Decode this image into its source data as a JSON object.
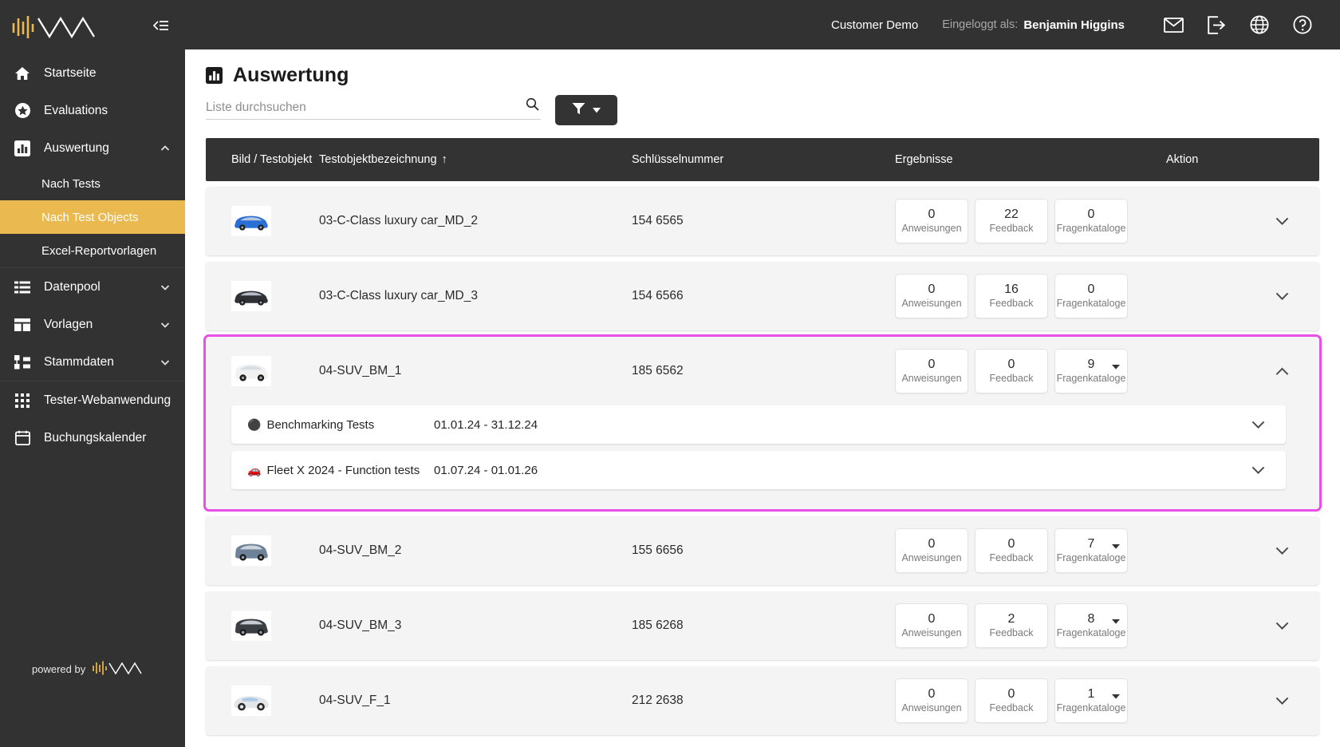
{
  "sidebar": {
    "brand_logo_name": "app-logo",
    "collapse_icon": "collapse-sidebar-icon",
    "items": [
      {
        "label": "Startseite",
        "icon": "home-icon",
        "type": "link",
        "active": false
      },
      {
        "label": "Evaluations",
        "icon": "star-icon",
        "type": "link",
        "active": false
      },
      {
        "label": "Auswertung",
        "icon": "bar-chart-icon",
        "type": "group",
        "expanded": true,
        "chevron": "chevron-up-icon"
      },
      {
        "label": "Nach Tests",
        "type": "sub",
        "active": false
      },
      {
        "label": "Nach Test Objects",
        "type": "sub",
        "active": true
      },
      {
        "label": "Excel-Reportvorlagen",
        "type": "sub",
        "active": false
      },
      {
        "label": "Datenpool",
        "icon": "list-icon",
        "type": "group",
        "expanded": false,
        "chevron": "chevron-down-icon"
      },
      {
        "label": "Vorlagen",
        "icon": "layout-icon",
        "type": "group",
        "expanded": false,
        "chevron": "chevron-down-icon"
      },
      {
        "label": "Stammdaten",
        "icon": "hierarchy-icon",
        "type": "group",
        "expanded": false,
        "chevron": "chevron-down-icon"
      },
      {
        "label": "Tester-Webanwendung",
        "icon": "grid-icon",
        "type": "link",
        "active": false
      },
      {
        "label": "Buchungskalender",
        "icon": "calendar-icon",
        "type": "link",
        "active": false
      }
    ],
    "powered_by_label": "powered by"
  },
  "topbar": {
    "tenant": "Customer Demo",
    "loggedin_label": "Eingeloggt als:",
    "user_name": "Benjamin Higgins",
    "icons": [
      "mail-icon",
      "logout-icon",
      "globe-icon",
      "help-icon"
    ]
  },
  "page": {
    "title": "Auswertung",
    "title_icon": "bar-chart-icon"
  },
  "search": {
    "placeholder": "Liste durchsuchen",
    "value": "",
    "icon": "search-icon"
  },
  "filter_button": {
    "icon": "filter-icon",
    "caret": "caret-down-icon"
  },
  "table": {
    "columns": [
      {
        "key": "image",
        "label": "Bild / Testobjekt"
      },
      {
        "key": "name",
        "label": "Testobjektbezeichnung",
        "sorted": true,
        "sort_arrow": "↑"
      },
      {
        "key": "keynum",
        "label": "Schlüsselnummer"
      },
      {
        "key": "result",
        "label": "Ergebnisse"
      },
      {
        "key": "action",
        "label": "Aktion"
      }
    ],
    "result_labels": {
      "instructions": "Anweisungen",
      "feedback": "Feedback",
      "catalogs": "Fragenkataloge"
    },
    "rows": [
      {
        "name": "03-C-Class luxury car_MD_2",
        "keynum": "154 6565",
        "thumb": "sedan-blue-thumb",
        "instructions": "0",
        "feedback": "22",
        "catalogs": "0",
        "catalogs_has_caret": false,
        "expanded": false,
        "highlight": false,
        "chevron": "chevron-down-icon",
        "sub_rows": []
      },
      {
        "name": "03-C-Class luxury car_MD_3",
        "keynum": "154 6566",
        "thumb": "sedan-black-thumb",
        "instructions": "0",
        "feedback": "16",
        "catalogs": "0",
        "catalogs_has_caret": false,
        "expanded": false,
        "highlight": false,
        "chevron": "chevron-down-icon",
        "sub_rows": []
      },
      {
        "name": "04-SUV_BM_1",
        "keynum": "185 6562",
        "thumb": "suv-white-thumb",
        "instructions": "0",
        "feedback": "0",
        "catalogs": "9",
        "catalogs_has_caret": true,
        "expanded": true,
        "highlight": true,
        "chevron": "chevron-up-icon",
        "sub_rows": [
          {
            "emoji": "⚫",
            "name": "Benchmarking Tests",
            "date_range": "01.01.24 - 31.12.24",
            "chevron": "chevron-down-icon"
          },
          {
            "emoji": "🚗",
            "name": "Fleet X 2024 - Function tests",
            "date_range": "01.07.24 - 01.01.26",
            "chevron": "chevron-down-icon"
          }
        ]
      },
      {
        "name": "04-SUV_BM_2",
        "keynum": "155 6656",
        "thumb": "suv-blue-thumb",
        "instructions": "0",
        "feedback": "0",
        "catalogs": "7",
        "catalogs_has_caret": true,
        "expanded": false,
        "highlight": false,
        "chevron": "chevron-down-icon",
        "sub_rows": []
      },
      {
        "name": "04-SUV_BM_3",
        "keynum": "185 6268",
        "thumb": "suv-dark-thumb",
        "instructions": "0",
        "feedback": "2",
        "catalogs": "8",
        "catalogs_has_caret": true,
        "expanded": false,
        "highlight": false,
        "chevron": "chevron-down-icon",
        "sub_rows": []
      },
      {
        "name": "04-SUV_F_1",
        "keynum": "212 2638",
        "thumb": "suv-silver-thumb",
        "instructions": "0",
        "feedback": "0",
        "catalogs": "1",
        "catalogs_has_caret": true,
        "expanded": false,
        "highlight": false,
        "chevron": "chevron-down-icon",
        "sub_rows": []
      }
    ]
  },
  "colors": {
    "sidebar_bg": "#323232",
    "accent_active": "#eab950",
    "highlight_outline": "#e84fe8",
    "header_row_bg": "#333333",
    "row_bg": "#f4f4f4"
  }
}
